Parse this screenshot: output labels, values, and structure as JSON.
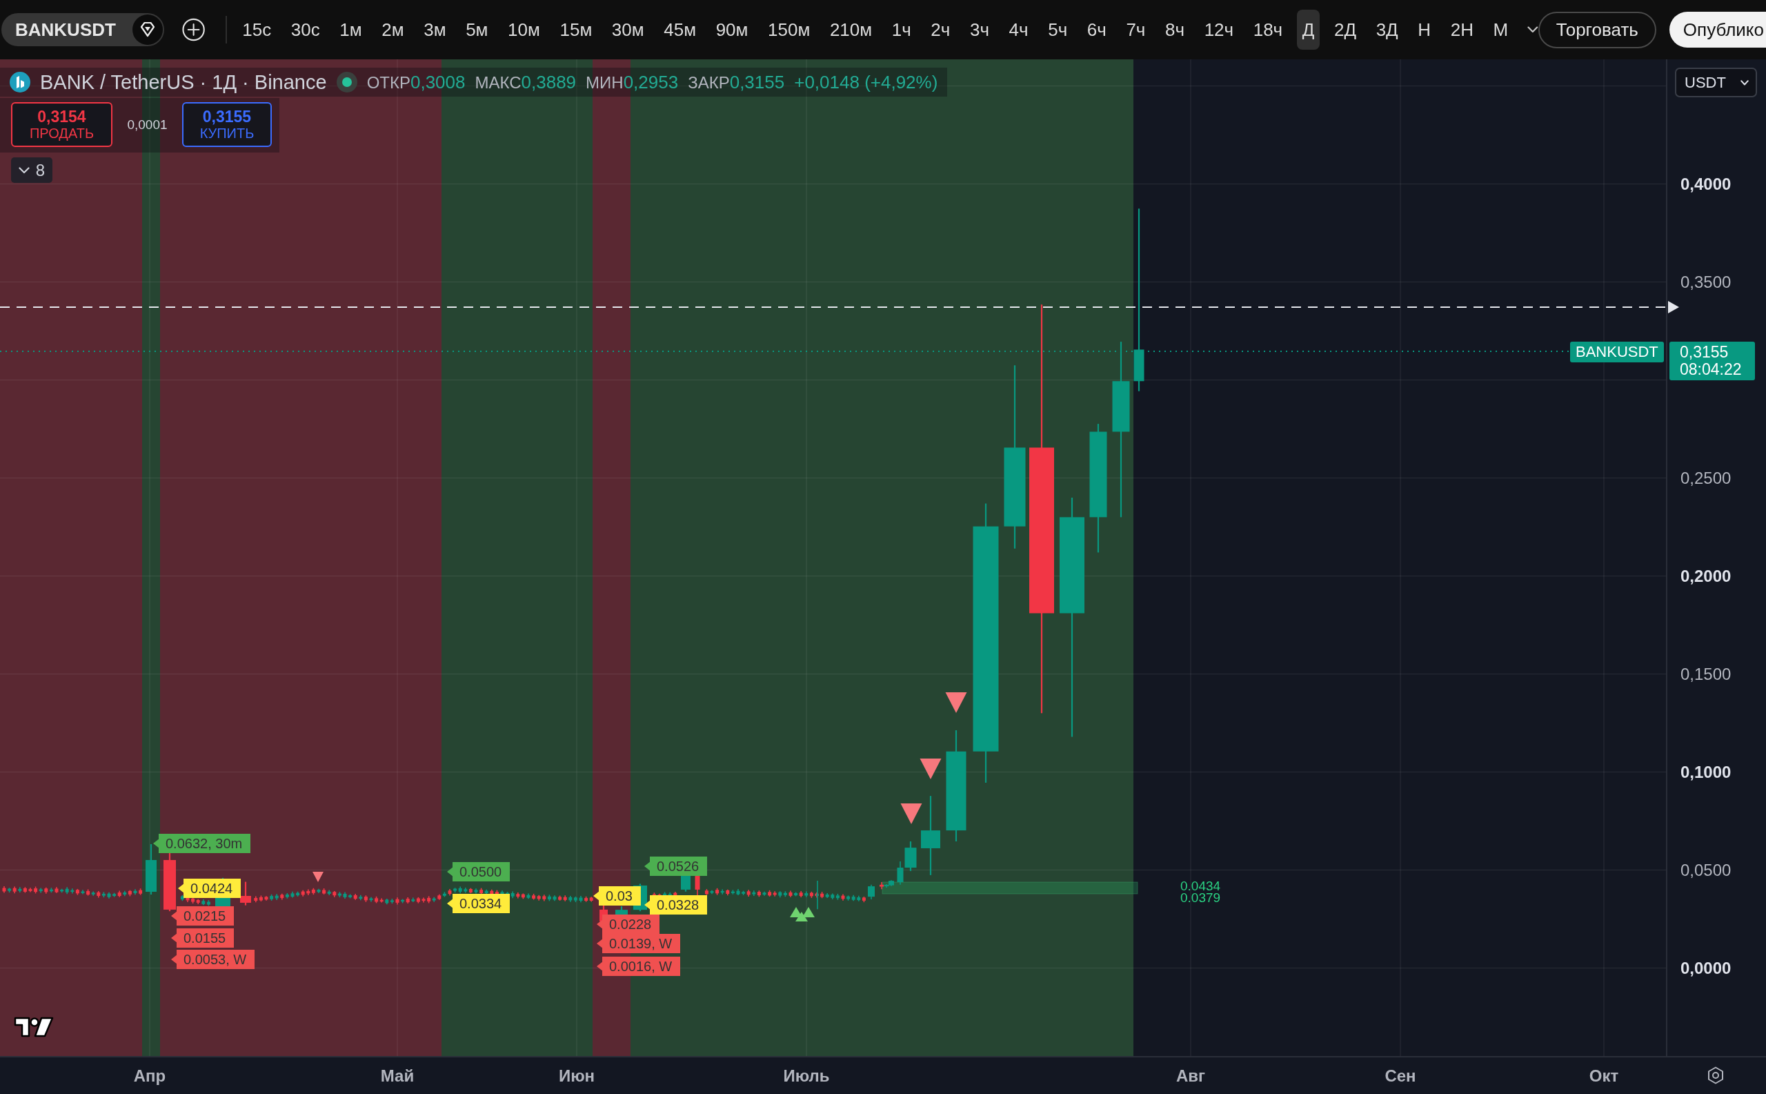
{
  "toolbar": {
    "symbol": "BANKUSDT",
    "timeframes": [
      {
        "label": "15с",
        "selected": false
      },
      {
        "label": "30с",
        "selected": false
      },
      {
        "label": "1м",
        "selected": false
      },
      {
        "label": "2м",
        "selected": false
      },
      {
        "label": "3м",
        "selected": false
      },
      {
        "label": "5м",
        "selected": false
      },
      {
        "label": "10м",
        "selected": false
      },
      {
        "label": "15м",
        "selected": false
      },
      {
        "label": "30м",
        "selected": false
      },
      {
        "label": "45м",
        "selected": false
      },
      {
        "label": "90м",
        "selected": false
      },
      {
        "label": "150м",
        "selected": false
      },
      {
        "label": "210м",
        "selected": false
      },
      {
        "label": "1ч",
        "selected": false
      },
      {
        "label": "2ч",
        "selected": false
      },
      {
        "label": "3ч",
        "selected": false
      },
      {
        "label": "4ч",
        "selected": false
      },
      {
        "label": "5ч",
        "selected": false
      },
      {
        "label": "6ч",
        "selected": false
      },
      {
        "label": "7ч",
        "selected": false
      },
      {
        "label": "8ч",
        "selected": false
      },
      {
        "label": "12ч",
        "selected": false
      },
      {
        "label": "18ч",
        "selected": false
      },
      {
        "label": "Д",
        "selected": true
      },
      {
        "label": "2Д",
        "selected": false
      },
      {
        "label": "3Д",
        "selected": false
      },
      {
        "label": "Н",
        "selected": false
      },
      {
        "label": "2Н",
        "selected": false
      },
      {
        "label": "М",
        "selected": false
      }
    ],
    "trade_button": "Торговать",
    "publish_button": "Опублико"
  },
  "legend": {
    "title": "BANK / TetherUS · 1Д · Binance",
    "values": [
      {
        "label": "ОТКР",
        "value": "0,3008"
      },
      {
        "label": "МАКС",
        "value": "0,3889"
      },
      {
        "label": "МИН",
        "value": "0,2953"
      },
      {
        "label": "ЗАКР",
        "value": "0,3155"
      }
    ],
    "change": "+0,0148 (+4,92%)"
  },
  "trade_panel": {
    "sell": {
      "price": "0,3154",
      "label": "ПРОДАТЬ"
    },
    "spread": "0,0001",
    "buy": {
      "price": "0,3155",
      "label": "КУПИТЬ"
    }
  },
  "indicators": {
    "count": "8",
    "expanded": false
  },
  "currency": "USDT",
  "price_axis": {
    "labels": [
      {
        "text": "0,4000",
        "major": true
      },
      {
        "text": "0,3500",
        "major": false
      },
      {
        "text": "0,2500",
        "major": false
      },
      {
        "text": "0,2000",
        "major": true
      },
      {
        "text": "0,1500",
        "major": false
      },
      {
        "text": "0,1000",
        "major": true
      },
      {
        "text": "0,0500",
        "major": false
      },
      {
        "text": "0,0000",
        "major": true
      }
    ]
  },
  "price_tag": {
    "symbol": "BANKUSDT",
    "price": "0,3155",
    "countdown": "08:04:22"
  },
  "level_labels": [
    {
      "text": "0.0632, 30m",
      "color": "#4caf50"
    },
    {
      "text": "0.0424",
      "color": "#ffeb3b"
    },
    {
      "text": "0.0215",
      "color": "#f05050"
    },
    {
      "text": "0.0155",
      "color": "#f05050"
    },
    {
      "text": "0.0053, W",
      "color": "#f05050"
    },
    {
      "text": "0.0500",
      "color": "#4caf50"
    },
    {
      "text": "0.0334",
      "color": "#ffeb3b"
    },
    {
      "text": "0.03",
      "color": "#ffeb3b"
    },
    {
      "text": "0.0526",
      "color": "#4caf50"
    },
    {
      "text": "0.0328",
      "color": "#ffeb3b"
    },
    {
      "text": "0.0228",
      "color": "#f05050"
    },
    {
      "text": "0.0139, W",
      "color": "#f05050"
    },
    {
      "text": "0.0016, W",
      "color": "#f05050"
    }
  ],
  "range_labels": [
    "0.0434",
    "0.0379"
  ],
  "time_axis": {
    "labels": [
      "Апр",
      "Май",
      "Июн",
      "Июль",
      "Авг",
      "Сен",
      "Окт"
    ]
  }
}
